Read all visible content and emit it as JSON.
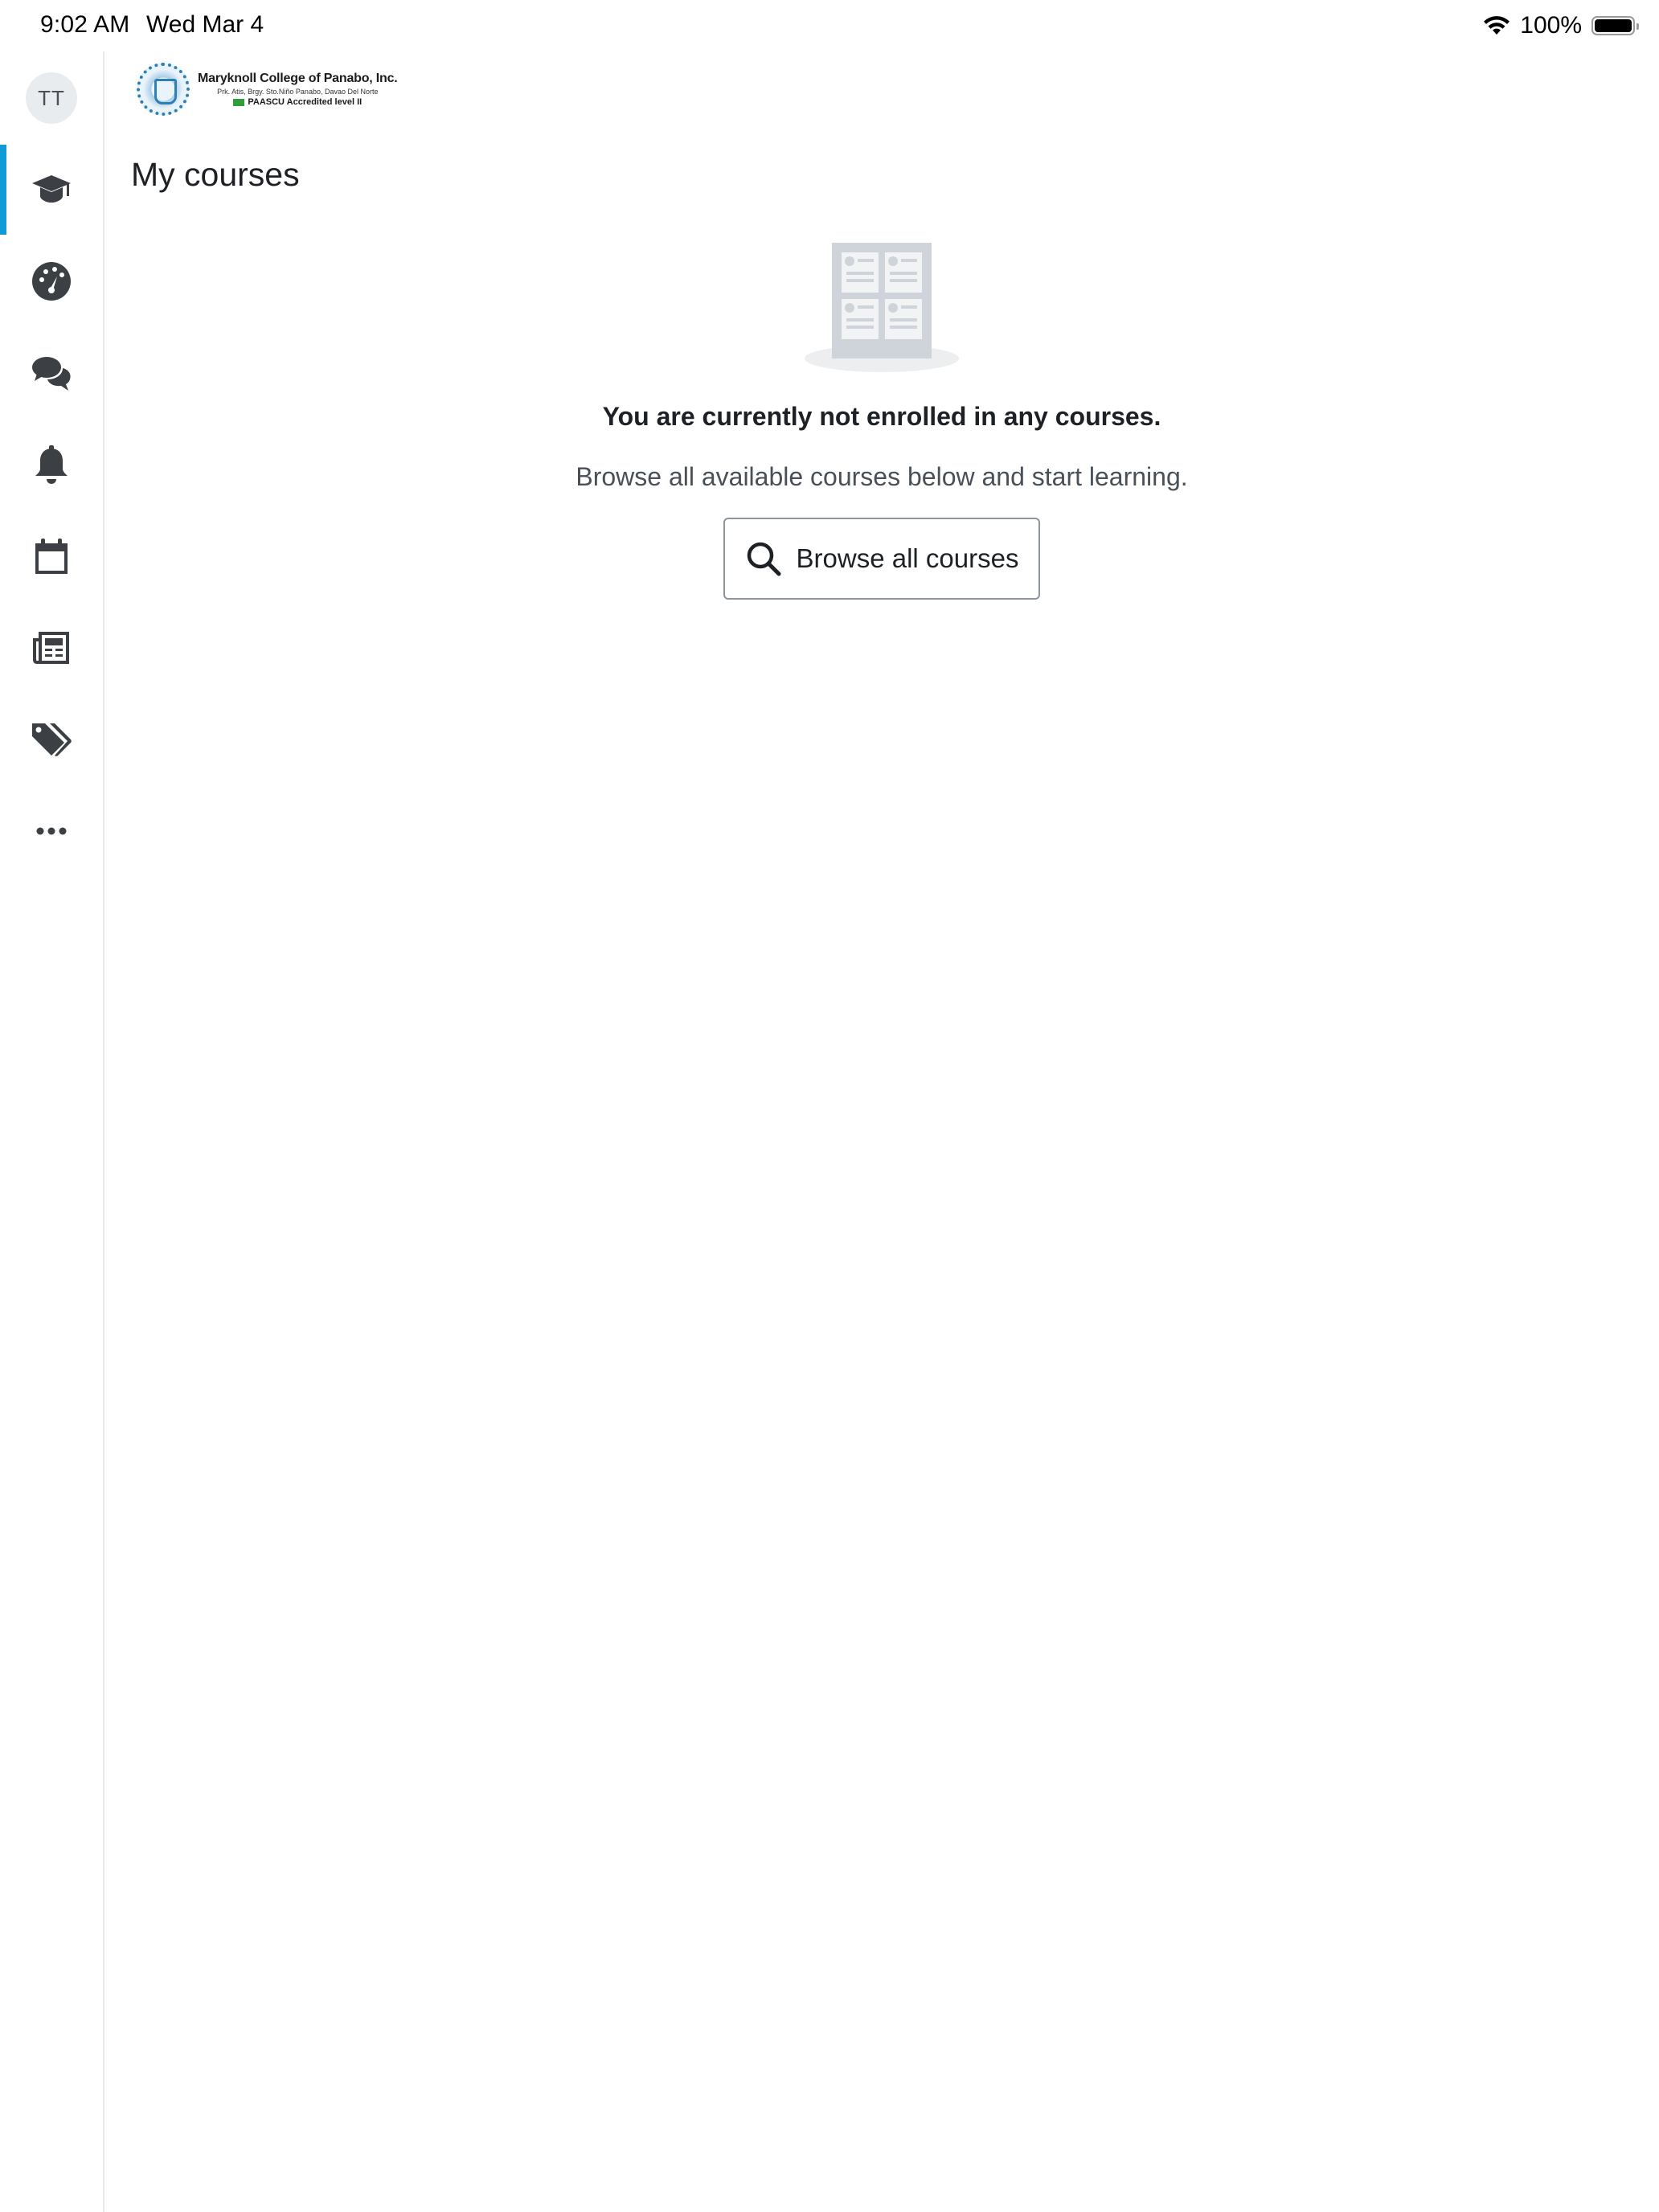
{
  "status_bar": {
    "time": "9:02 AM",
    "date": "Wed Mar 4",
    "battery_percent": "100%",
    "battery_level": 1.0,
    "wifi_icon": "wifi-icon"
  },
  "rail": {
    "avatar_initials": "TT",
    "accent_color": "#0f9bd7",
    "items": [
      {
        "id": "my-courses",
        "icon": "graduation-cap-icon",
        "active": true
      },
      {
        "id": "dashboard",
        "icon": "dashboard-gauge-icon",
        "active": false
      },
      {
        "id": "messages",
        "icon": "chat-bubbles-icon",
        "active": false
      },
      {
        "id": "notifications",
        "icon": "bell-icon",
        "active": false
      },
      {
        "id": "calendar",
        "icon": "calendar-icon",
        "active": false
      },
      {
        "id": "news",
        "icon": "newspaper-icon",
        "active": false
      },
      {
        "id": "tags",
        "icon": "tags-icon",
        "active": false
      },
      {
        "id": "more",
        "icon": "more-dots-icon",
        "active": false
      }
    ]
  },
  "header": {
    "logo": {
      "name": "Maryknoll College of Panabo, Inc.",
      "address": "Prk. Atis, Brgy. Sto.Niño Panabo, Davao Del Norte",
      "accreditation": "PAASCU Accredited level II"
    }
  },
  "main": {
    "title": "My courses",
    "empty_state": {
      "heading": "You are currently not enrolled in any courses.",
      "subtext": "Browse all available courses below and start learning.",
      "button_label": "Browse all courses",
      "button_icon": "search-icon"
    }
  }
}
